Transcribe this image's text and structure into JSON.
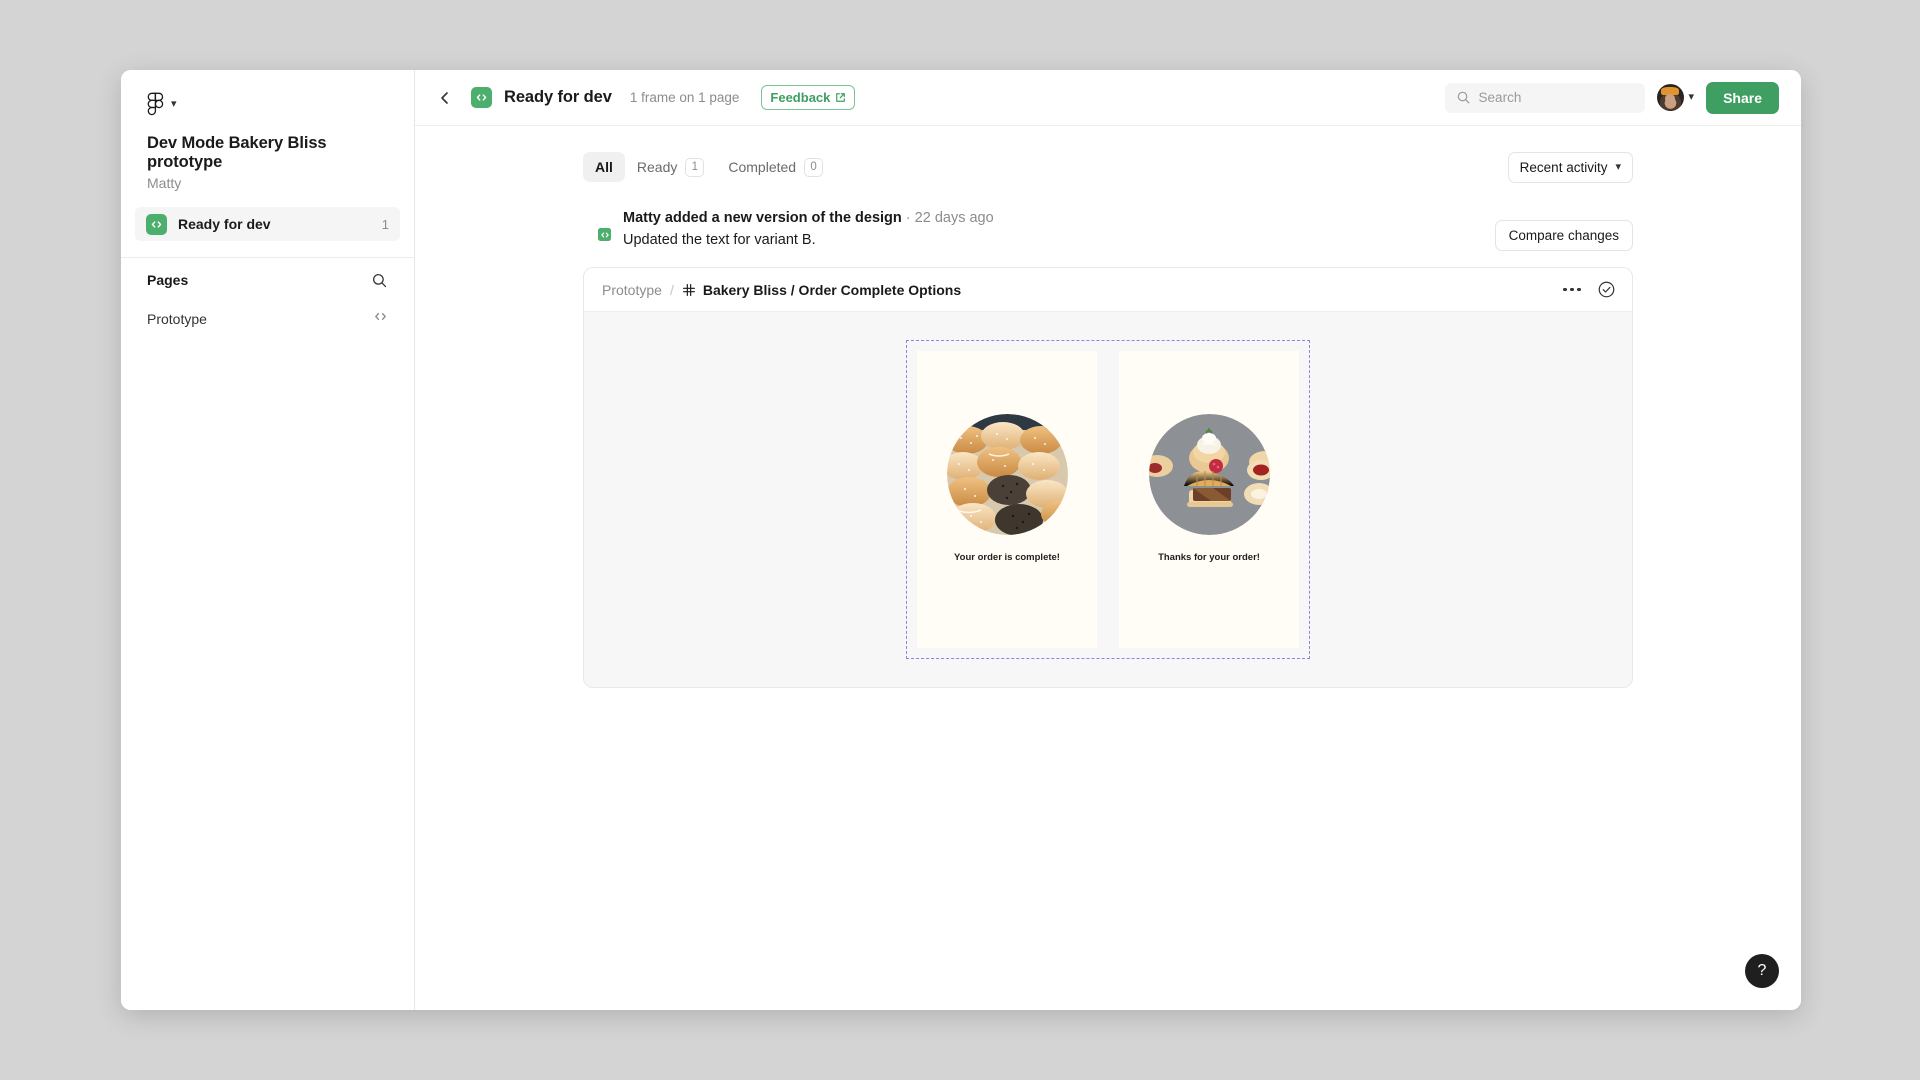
{
  "sidebar": {
    "logo_icon": "figma-logo-icon",
    "logo_chevron_icon": "chevron-down-icon",
    "project_title": "Dev Mode Bakery Bliss prototype",
    "project_owner": "Matty",
    "ready_for_dev": {
      "label": "Ready for dev",
      "count": "1",
      "icon": "code-icon"
    },
    "pages_header": {
      "label": "Pages",
      "search_icon": "search-icon"
    },
    "pages": [
      {
        "name": "Prototype",
        "trailing_icon": "code-icon"
      }
    ]
  },
  "topbar": {
    "back_icon": "chevron-left-icon",
    "status_icon": "code-icon",
    "title": "Ready for dev",
    "subtitle": "1 frame on 1 page",
    "feedback": {
      "label": "Feedback",
      "icon": "external-link-icon"
    },
    "search": {
      "placeholder": "Search",
      "value": "",
      "icon": "search-icon"
    },
    "avatar": {
      "name": "user-avatar",
      "chevron_icon": "chevron-down-icon"
    },
    "share_label": "Share"
  },
  "filters": {
    "tabs": [
      {
        "label": "All",
        "count": "",
        "active": true
      },
      {
        "label": "Ready",
        "count": "1",
        "active": false
      },
      {
        "label": "Completed",
        "count": "0",
        "active": false
      }
    ],
    "sort": {
      "label": "Recent activity",
      "icon": "chevron-down-icon"
    }
  },
  "activity": {
    "author": "Matty added a new version of the design",
    "separator": " · ",
    "timestamp": "22 days ago",
    "description": "Updated the text for variant B.",
    "compare_label": "Compare changes",
    "badge_icon": "code-icon"
  },
  "design_card": {
    "breadcrumb_parent": "Prototype",
    "breadcrumb_separator": "/",
    "frame_icon": "frame-hash-icon",
    "breadcrumb_current": "Bakery Bliss / Order Complete Options",
    "more_icon": "more-options-icon",
    "status_icon": "check-circle-icon",
    "frames": [
      {
        "caption": "Your order is complete!",
        "image": "bread-rolls-photo"
      },
      {
        "caption": "Thanks for your order!",
        "image": "assorted-pastries-photo"
      }
    ]
  },
  "help": {
    "label": "?",
    "icon": "question-mark-icon"
  },
  "colors": {
    "accent_green": "#3f9e62",
    "badge_green": "#4caf6d",
    "selection_purple": "#9b7ce0",
    "frame_bg": "#fffdf5"
  }
}
